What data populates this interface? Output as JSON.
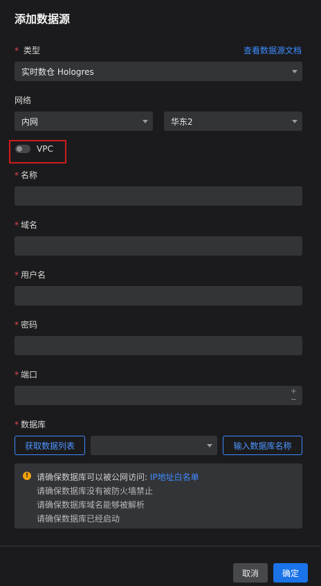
{
  "dialog": {
    "title": "添加数据源"
  },
  "type_field": {
    "label": "类型",
    "doc_link": "查看数据源文档",
    "value": "实时数仓 Hologres"
  },
  "network": {
    "label": "网络",
    "network_value": "内网",
    "region_value": "华东2",
    "vpc_label": "VPC",
    "vpc_enabled": false
  },
  "fields": {
    "name_label": "名称",
    "domain_label": "域名",
    "username_label": "用户名",
    "password_label": "密码",
    "port_label": "端口",
    "database_label": "数据库"
  },
  "database": {
    "fetch_list_label": "获取数据列表",
    "selected_value": "",
    "enter_name_label": "输入数据库名称"
  },
  "notice": {
    "line1_prefix": "请确保数据库可以被公网访问:",
    "line1_link": "IP地址白名单",
    "line2": "请确保数据库没有被防火墙禁止",
    "line3": "请确保数据库域名能够被解析",
    "line4": "请确保数据库已经启动"
  },
  "footer": {
    "cancel_label": "取消",
    "confirm_label": "确定"
  },
  "colors": {
    "accent": "#1a73e8",
    "link": "#3d8bff",
    "required": "#e5484d",
    "warning_icon": "#f2a20c",
    "highlight_box": "#d21b1b"
  }
}
